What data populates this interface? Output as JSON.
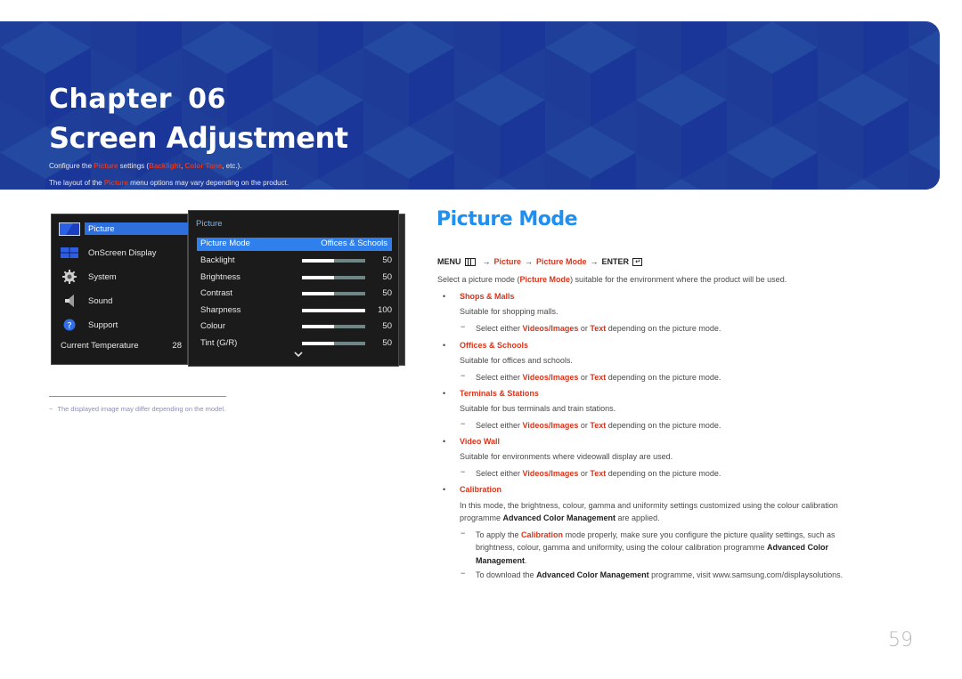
{
  "banner": {
    "chapter_label": "Chapter",
    "chapter_number": "06",
    "title": "Screen Adjustment",
    "desc1": {
      "pre": "Configure the ",
      "h1": "Picture",
      "mid": " settings (",
      "h2": "Backlight",
      "comma": ", ",
      "h3": "Color Tone",
      "post": ", etc.)."
    },
    "desc2": {
      "pre": "The layout of the ",
      "h1": "Picture",
      "post": " menu options may vary depending on the product."
    },
    "color": "#1f3e9a"
  },
  "osd": {
    "left_menu": [
      {
        "label": "Picture",
        "icon": "picture-icon",
        "active": true
      },
      {
        "label": "OnScreen Display",
        "icon": "onscreen-display-icon"
      },
      {
        "label": "System",
        "icon": "gear-icon"
      },
      {
        "label": "Sound",
        "icon": "speaker-icon"
      },
      {
        "label": "Support",
        "icon": "question-icon"
      }
    ],
    "temperature_label": "Current Temperature",
    "temperature_value": "28",
    "submenu_title": "Picture",
    "selected": {
      "label": "Picture Mode",
      "value": "Offices & Schools"
    },
    "settings": [
      {
        "label": "Backlight",
        "value": "50",
        "level": 0.5
      },
      {
        "label": "Brightness",
        "value": "50",
        "level": 0.5
      },
      {
        "label": "Contrast",
        "value": "50",
        "level": 0.5
      },
      {
        "label": "Sharpness",
        "value": "100",
        "level": 1.0
      },
      {
        "label": "Colour",
        "value": "50",
        "level": 0.5
      },
      {
        "label": "Tint (G/R)",
        "value": "50",
        "level": 0.5
      }
    ],
    "highlight_color": "#2f80ec"
  },
  "footnote": {
    "dash": "−",
    "text": "The displayed image may differ depending on the model."
  },
  "section": {
    "title": "Picture Mode",
    "path": {
      "menu": "MENU",
      "arrow": "→",
      "p1": "Picture",
      "p2": "Picture Mode",
      "enter": "ENTER"
    },
    "intro": {
      "pre": "Select a picture mode (",
      "bold": "Picture Mode",
      "post": ") suitable for the environment where the product will be used."
    },
    "bullet": "•",
    "dash": "−",
    "modes": [
      {
        "name": "Shops & Malls",
        "desc": "Suitable for shopping malls."
      },
      {
        "name": "Offices & Schools",
        "desc": "Suitable for offices and schools."
      },
      {
        "name": "Terminals & Stations",
        "desc": "Suitable for bus terminals and train stations."
      },
      {
        "name": "Video Wall",
        "desc": "Suitable for environments where videowall display are used."
      }
    ],
    "select_note": {
      "pre": "Select either ",
      "b1": "Videos/Images",
      "mid": " or ",
      "b2": "Text",
      "post": " depending on the picture mode."
    },
    "calibration": {
      "name": "Calibration",
      "line1": "In this mode, the brightness, colour, gamma and uniformity settings customized using the colour calibration",
      "line2_pre": "programme ",
      "line2_bold": "Advanced Color Management",
      "line2_post": " are applied.",
      "note1_pre": "To apply the ",
      "note1_red": "Calibration",
      "note1_post": " mode properly, make sure you configure the picture quality settings, such as",
      "note1_line2_pre": "brightness, colour, gamma and uniformity, using the colour calibration programme ",
      "note1_line2_bold": "Advanced Color",
      "note1_line3_bold": "Management",
      "note1_line3_post": ".",
      "note2_pre": "To download the ",
      "note2_bold": "Advanced Color Management",
      "note2_post": " programme, visit www.samsung.com/displaysolutions."
    },
    "accent_color": "#1f8ff0",
    "red_color": "#d9351c"
  },
  "page_number": "59"
}
